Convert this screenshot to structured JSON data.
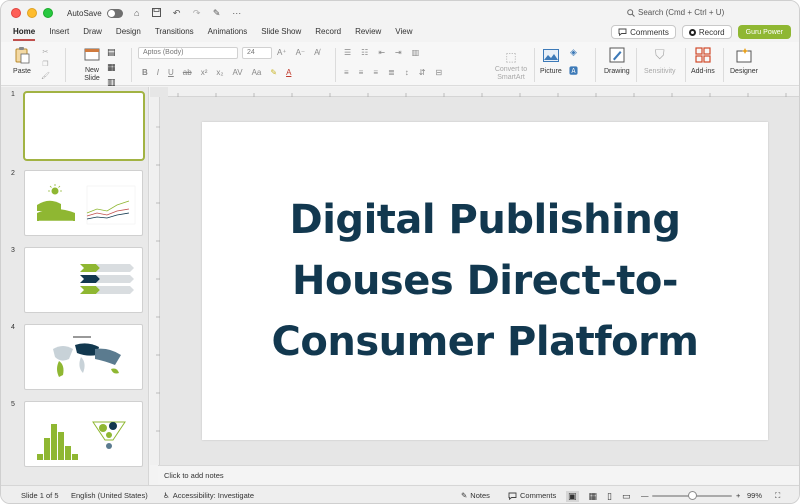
{
  "titlebar": {
    "autosave_label": "AutoSave",
    "more": "···",
    "search_placeholder": "Search (Cmd + Ctrl + U)"
  },
  "tabs": [
    "Home",
    "Insert",
    "Draw",
    "Design",
    "Transitions",
    "Animations",
    "Slide Show",
    "Record",
    "Review",
    "View"
  ],
  "actions": {
    "comments": "Comments",
    "record": "Record",
    "guru": "Guru Power"
  },
  "ribbon": {
    "paste": "Paste",
    "new_slide": "New Slide",
    "font_name": "Aptos (Body)",
    "font_size": "24",
    "convert_smartart": "Convert to SmartArt",
    "picture": "Picture",
    "drawing": "Drawing",
    "sensitivity": "Sensitivity",
    "addins": "Add-ins",
    "designer": "Designer"
  },
  "thumbnails": [
    {
      "num": "1"
    },
    {
      "num": "2"
    },
    {
      "num": "3"
    },
    {
      "num": "4"
    },
    {
      "num": "5"
    }
  ],
  "slide": {
    "title_lines": [
      "Digital Publishing",
      "Houses Direct-to-",
      "Consumer Platform"
    ]
  },
  "notes": {
    "placeholder": "Click to add notes"
  },
  "status": {
    "slide_count": "Slide 1 of 5",
    "language": "English (United States)",
    "accessibility": "Accessibility: Investigate",
    "notes": "Notes",
    "comments": "Comments",
    "zoom": "99%"
  },
  "colors": {
    "accent_green": "#8fb732",
    "title_navy": "#12384f",
    "tab_underline": "#c0504d"
  }
}
